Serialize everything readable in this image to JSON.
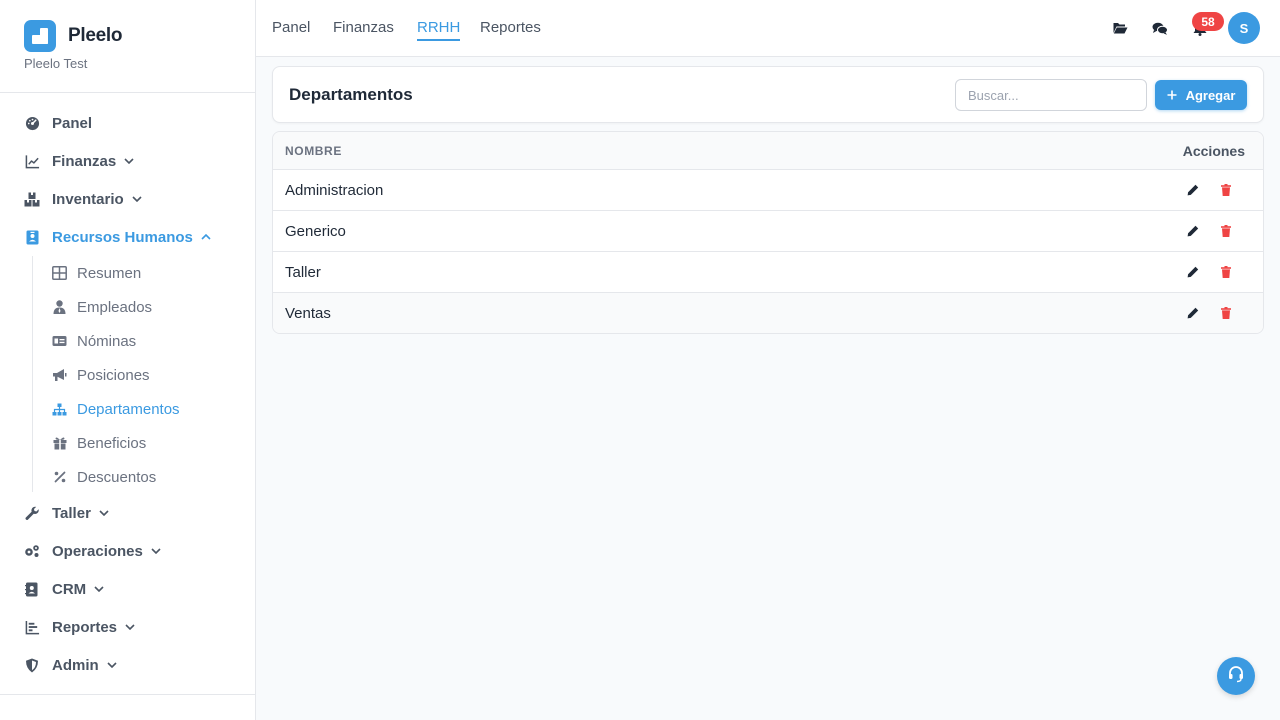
{
  "brand": {
    "name": "Pleelo",
    "subtitle": "Pleelo Test",
    "accent": "#3b9ae1"
  },
  "sidebar": {
    "items": [
      {
        "label": "Panel",
        "icon": "dashboard-icon"
      },
      {
        "label": "Finanzas",
        "icon": "chart-line-icon",
        "expandable": true
      },
      {
        "label": "Inventario",
        "icon": "boxes-icon",
        "expandable": true
      },
      {
        "label": "Recursos Humanos",
        "icon": "id-badge-icon",
        "expandable": true,
        "expanded": true,
        "active": true
      },
      {
        "label": "Taller",
        "icon": "wrench-icon",
        "expandable": true
      },
      {
        "label": "Operaciones",
        "icon": "cogs-icon",
        "expandable": true
      },
      {
        "label": "CRM",
        "icon": "contact-book-icon",
        "expandable": true
      },
      {
        "label": "Reportes",
        "icon": "bar-chart-icon",
        "expandable": true
      },
      {
        "label": "Admin",
        "icon": "shield-icon",
        "expandable": true
      }
    ],
    "rrhh_subitems": [
      {
        "label": "Resumen",
        "icon": "table-icon"
      },
      {
        "label": "Empleados",
        "icon": "user-tie-icon"
      },
      {
        "label": "Nóminas",
        "icon": "money-card-icon"
      },
      {
        "label": "Posiciones",
        "icon": "megaphone-icon"
      },
      {
        "label": "Departamentos",
        "icon": "sitemap-icon",
        "active": true
      },
      {
        "label": "Beneficios",
        "icon": "gift-icon"
      },
      {
        "label": "Descuentos",
        "icon": "percent-icon"
      }
    ]
  },
  "topbar": {
    "tabs": [
      {
        "label": "Panel"
      },
      {
        "label": "Finanzas"
      },
      {
        "label": "RRHH",
        "active": true
      },
      {
        "label": "Reportes"
      }
    ],
    "notification_count": "58",
    "avatar_initial": "S"
  },
  "main": {
    "title": "Departamentos",
    "search_placeholder": "Buscar...",
    "add_label": "Agregar",
    "table": {
      "col_name": "NOMBRE",
      "col_actions": "Acciones",
      "rows": [
        {
          "name": "Administracion"
        },
        {
          "name": "Generico"
        },
        {
          "name": "Taller"
        },
        {
          "name": "Ventas"
        }
      ]
    }
  },
  "colors": {
    "accent": "#3b9ae1",
    "danger": "#ef4444",
    "text": "#1f2937",
    "muted": "#6b7280"
  }
}
